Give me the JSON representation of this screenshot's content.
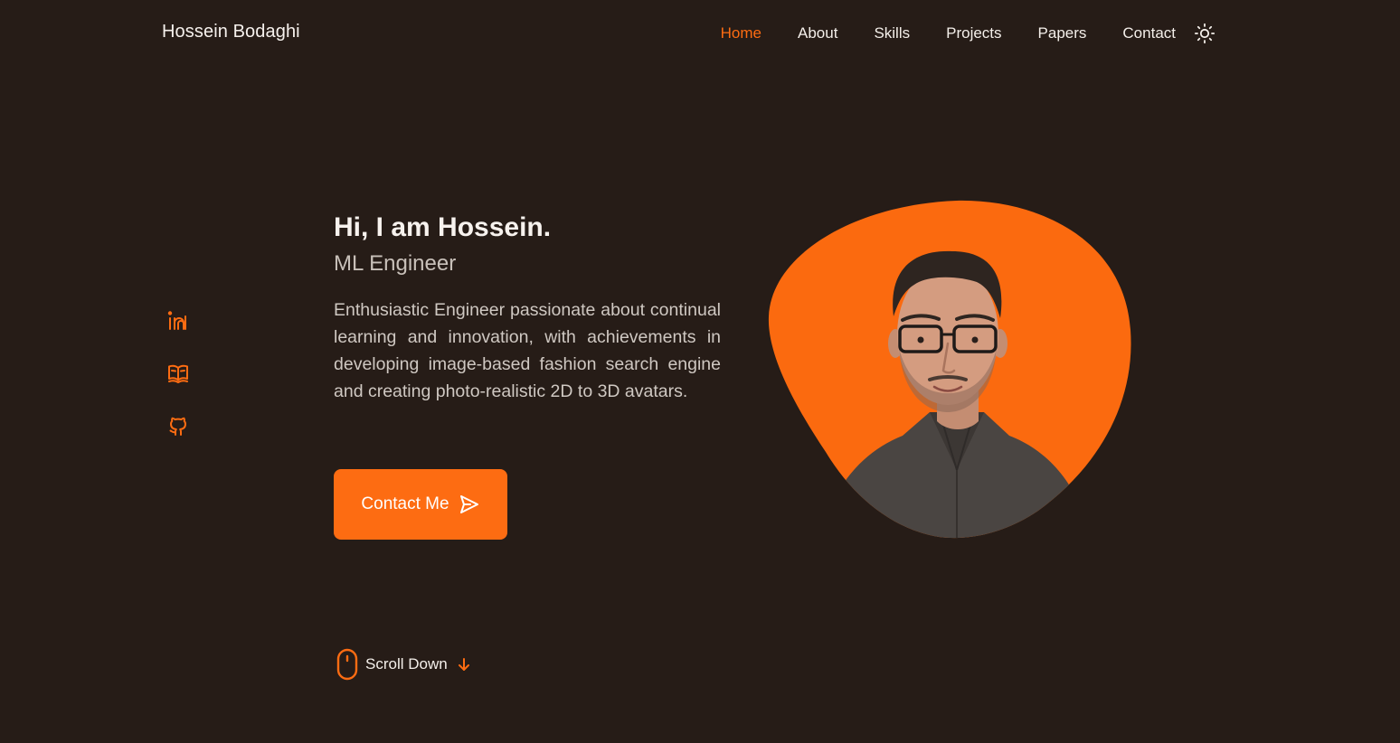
{
  "brand": "Hossein Bodaghi",
  "nav": {
    "items": [
      {
        "label": "Home",
        "active": true
      },
      {
        "label": "About",
        "active": false
      },
      {
        "label": "Skills",
        "active": false
      },
      {
        "label": "Projects",
        "active": false
      },
      {
        "label": "Papers",
        "active": false
      },
      {
        "label": "Contact",
        "active": false
      }
    ],
    "theme_toggle_icon": "sun-icon"
  },
  "socials": [
    {
      "icon": "linkedin-icon"
    },
    {
      "icon": "book-icon"
    },
    {
      "icon": "github-icon"
    }
  ],
  "hero": {
    "greeting": "Hi, I am Hossein.",
    "role": "ML Engineer",
    "description": "Enthusiastic Engineer passionate about continual learning and innovation, with achievements in developing image-based fashion search engine and creating photo-realistic 2D to 3D avatars.",
    "cta_label": "Contact Me",
    "cta_icon": "send-icon"
  },
  "scroll": {
    "label": "Scroll Down",
    "mouse_icon": "mouse-icon",
    "arrow_icon": "arrow-down-icon"
  },
  "colors": {
    "background": "#261c17",
    "accent": "#fd6c12",
    "text": "#f4efea",
    "muted": "#c8c0b9"
  }
}
